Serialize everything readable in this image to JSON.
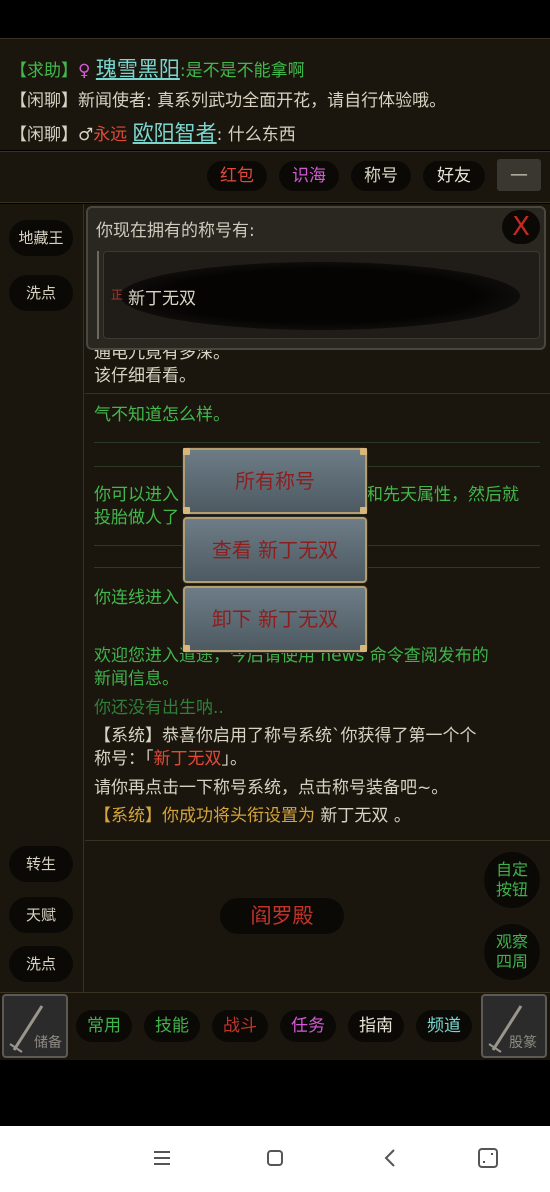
{
  "chat": {
    "lines": [
      {
        "tag": "【求助】",
        "gender": "♀",
        "name": "瑰雪黑阳",
        "sep": ":",
        "msg": "是不是不能拿啊"
      },
      {
        "tag": "【闲聊】",
        "name": "新闻使者",
        "sep": ":",
        "msg": "真系列武功全面开花，请自行体验哦。"
      },
      {
        "tag": "【闲聊】",
        "gender": "♂",
        "title": "永远",
        "name": "欧阳智者",
        "sep": ":",
        "msg": "什么东西"
      }
    ]
  },
  "top_buttons": {
    "hongbao": "红包",
    "shihai": "识海",
    "chenghao": "称号",
    "haoyou": "好友",
    "minus": "—"
  },
  "left_buttons": {
    "dizangwang": "地藏王",
    "xidian_top": "洗点",
    "zhuansheng": "转生",
    "tianfu": "天赋",
    "xidian_bottom": "洗点"
  },
  "right_buttons": {
    "custom": "自定\n按钮",
    "observe": "观察\n四周"
  },
  "title_panel": {
    "header": "你现在拥有的称号有:",
    "close": "X",
    "badge": "正",
    "item": "新丁无双"
  },
  "log": {
    "line0a": "通电九竟有多深。",
    "line0b": "该仔细看看。",
    "line1": "气不知道怎么样。",
    "line2a": "你可以进入",
    "line2b": "和先天属性，然后就",
    "line2c": "投胎做人了",
    "line3": "你连线进入",
    "line4a": "欢迎您进入道途，今后请使用 news 命令查阅发布的",
    "line4b": "新闻信息。",
    "line5": "你还没有出生呐..",
    "line6a": "【系统】恭喜你启用了称号系统`你获得了第一个个",
    "line6b_prefix": "称号：「",
    "line6b_title": "新丁无双",
    "line6b_suffix": "」。",
    "line7": "请你再点击一下称号系统，点击称号装备吧~。",
    "line8_prefix": "【系统】你成功将头衔设置为",
    "line8_title": "新丁无双",
    "line8_suffix": "。"
  },
  "menu": {
    "all": "所有称号",
    "view": "查看 新丁无双",
    "remove": "卸下 新丁无双"
  },
  "location": "阎罗殿",
  "tabs": {
    "common": "常用",
    "skill": "技能",
    "fight": "战斗",
    "task": "任务",
    "guide": "指南",
    "channel": "频道"
  },
  "swords": {
    "left": "储备",
    "right": "股篆"
  },
  "colors": {
    "green": "#42b84c",
    "red": "#e04a3a",
    "pink": "#d35ad6",
    "gold": "#d5a43a",
    "cyan": "#7bd6cf"
  }
}
